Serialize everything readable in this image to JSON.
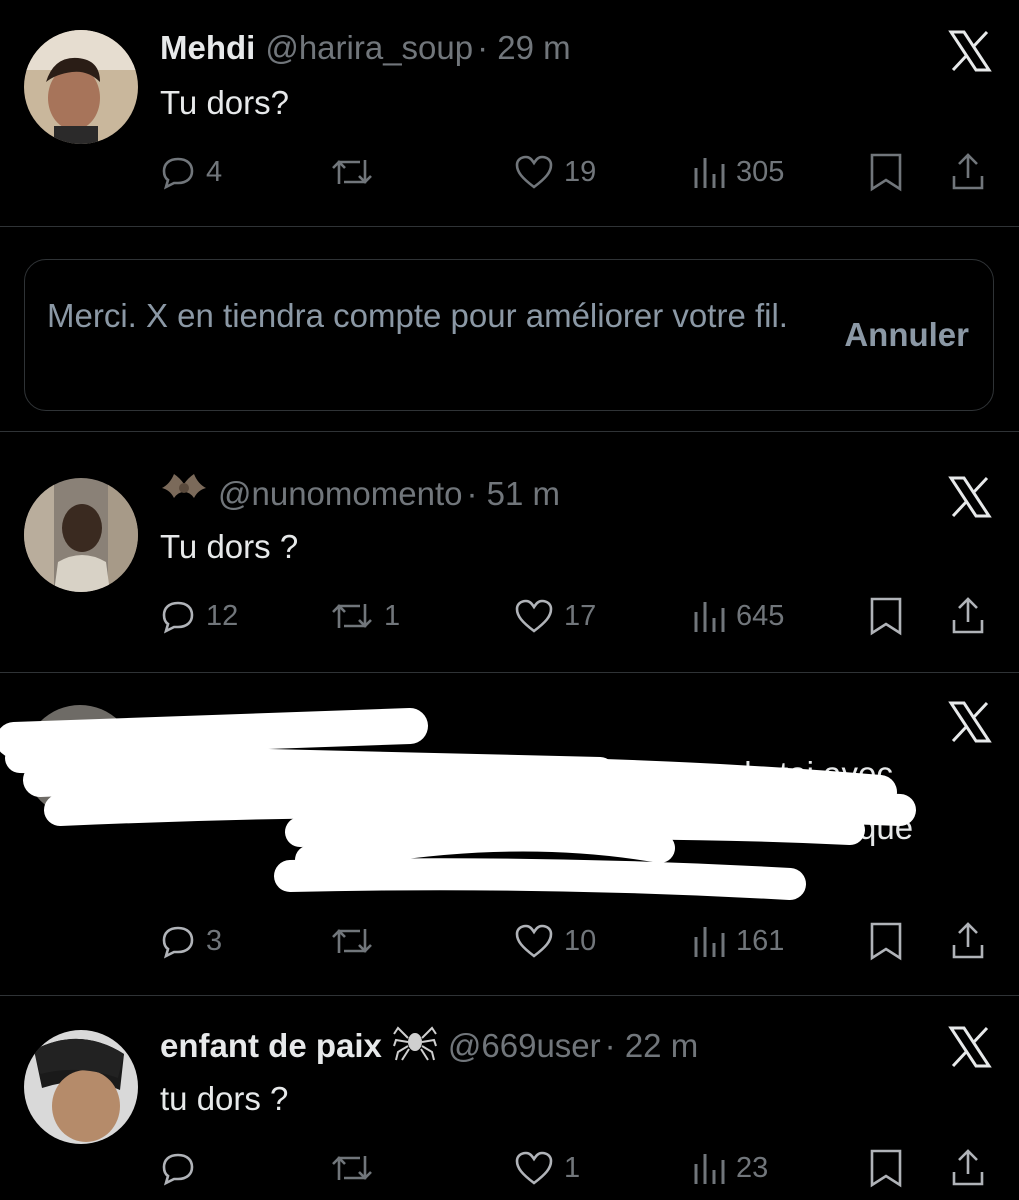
{
  "tweets": [
    {
      "name": "Mehdi",
      "handle": "@harira_soup",
      "time": "· 29 m",
      "text": "Tu dors?",
      "replies": "4",
      "reposts": "",
      "likes": "19",
      "views": "305"
    },
    {
      "name": "",
      "badge_icon": "bat-emoji",
      "handle": "@nunomomento",
      "time": "· 51 m",
      "text": "Tu dors ?",
      "replies": "12",
      "reposts": "1",
      "likes": "17",
      "views": "645"
    },
    {
      "redacted": true,
      "visible_fragments": [
        "sages de toi avec",
        "que"
      ],
      "replies": "3",
      "reposts": "",
      "likes": "10",
      "views": "161"
    },
    {
      "name": "enfant de paix",
      "badge_icon": "spider-emoji",
      "handle": "@669user",
      "time": "· 22 m",
      "text": "tu dors ?",
      "replies": "",
      "reposts": "",
      "likes": "1",
      "views": "23"
    }
  ],
  "feedback_banner": {
    "message": "Merci. X en tiendra compte pour améliorer votre fil.",
    "undo_label": "Annuler"
  },
  "colors": {
    "background": "#000000",
    "text": "#e7e9ea",
    "muted": "#71767b",
    "divider": "#2f3336"
  },
  "icons": [
    "x-logo-icon",
    "reply-icon",
    "repost-icon",
    "like-icon",
    "views-icon",
    "bookmark-icon",
    "share-icon"
  ]
}
